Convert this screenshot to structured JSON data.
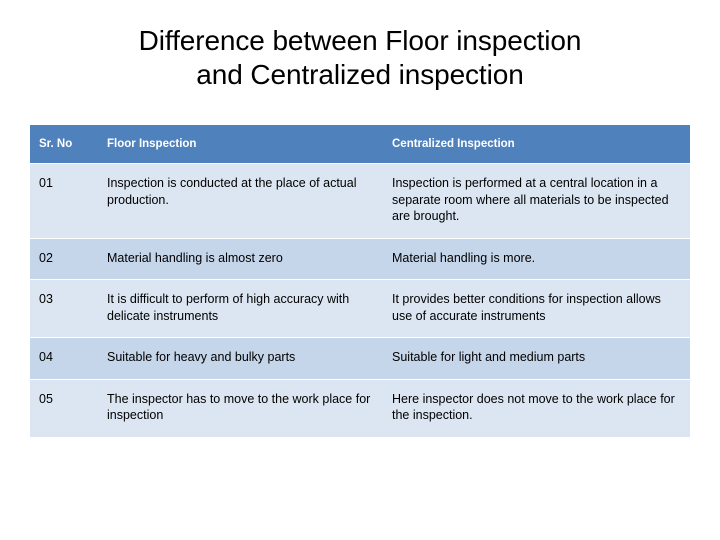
{
  "slide": {
    "title": "Difference between Floor inspection and Centralized inspection",
    "title_line1": "Difference between Floor inspection",
    "title_line2": "and Centralized inspection",
    "colors": {
      "header_bg": "#4F81BD",
      "header_text": "#FFFFFF",
      "row_light": "#DCE6F2",
      "row_dark": "#C5D5EA",
      "body_text": "#000000"
    }
  },
  "table": {
    "headers": [
      "Sr. No",
      "Floor Inspection",
      "Centralized Inspection"
    ],
    "rows": [
      {
        "sr_no": "01",
        "floor": "Inspection is conducted at the place of actual production.",
        "central": "Inspection is performed at a central location in a separate room where all materials to be inspected are brought."
      },
      {
        "sr_no": "02",
        "floor": "Material handling is almost zero",
        "central": "Material handling is more."
      },
      {
        "sr_no": "03",
        "floor": "It is difficult to perform of high accuracy with delicate instruments",
        "central": "It provides better conditions for inspection allows use of accurate instruments"
      },
      {
        "sr_no": "04",
        "floor": "Suitable for heavy and bulky parts",
        "central": "Suitable for light and medium parts"
      },
      {
        "sr_no": "05",
        "floor": "The inspector has to move to the work place for inspection",
        "central": "Here inspector does not move to the work place for the inspection."
      }
    ]
  }
}
